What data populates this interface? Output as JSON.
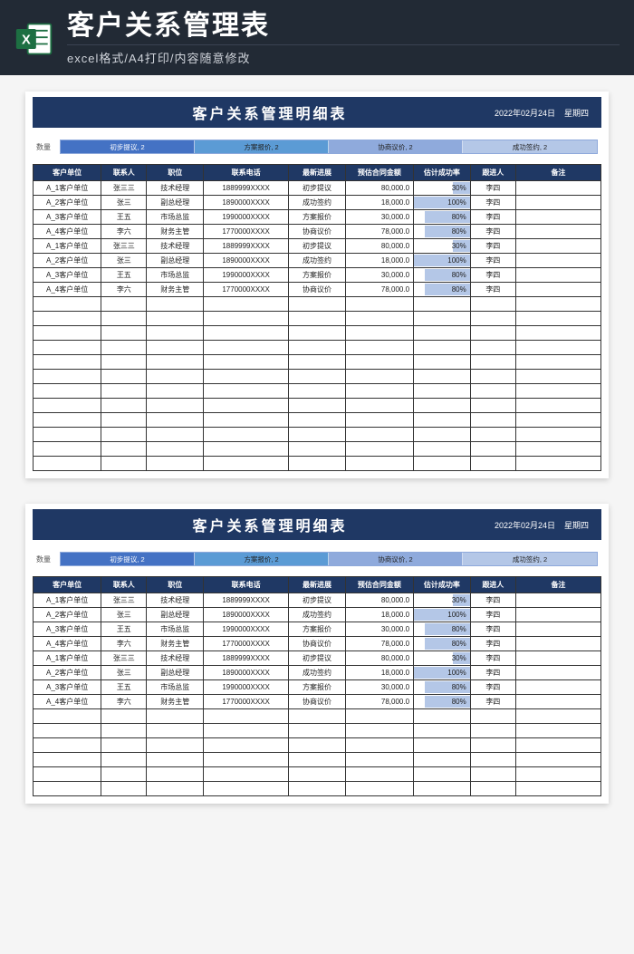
{
  "topbar": {
    "title": "客户关系管理表",
    "subtitle": "excel格式/A4打印/内容随意修改"
  },
  "sheet": {
    "title": "客户关系管理明细表",
    "date": "2022年02月24日",
    "weekday": "星期四",
    "chart_label": "数量",
    "segments": [
      {
        "label": "初步提议, 2",
        "pct": 25
      },
      {
        "label": "方案报价, 2",
        "pct": 25
      },
      {
        "label": "协商议价, 2",
        "pct": 25
      },
      {
        "label": "成功签约, 2",
        "pct": 25
      }
    ],
    "columns": [
      "客户单位",
      "联系人",
      "职位",
      "联系电话",
      "最新进展",
      "预估合同金额",
      "估计成功率",
      "跟进人",
      "备注"
    ],
    "rows": [
      {
        "unit": "A_1客户单位",
        "contact": "张三三",
        "title": "技术经理",
        "phone": "1889999XXXX",
        "progress": "初步提议",
        "amount": "80,000.0",
        "rate": "30%",
        "rate_pct": 30,
        "owner": "李四",
        "remark": ""
      },
      {
        "unit": "A_2客户单位",
        "contact": "张三",
        "title": "副总经理",
        "phone": "1890000XXXX",
        "progress": "成功签约",
        "amount": "18,000.0",
        "rate": "100%",
        "rate_pct": 100,
        "owner": "李四",
        "remark": ""
      },
      {
        "unit": "A_3客户单位",
        "contact": "王五",
        "title": "市场总监",
        "phone": "1990000XXXX",
        "progress": "方案报价",
        "amount": "30,000.0",
        "rate": "80%",
        "rate_pct": 80,
        "owner": "李四",
        "remark": ""
      },
      {
        "unit": "A_4客户单位",
        "contact": "李六",
        "title": "财务主管",
        "phone": "1770000XXXX",
        "progress": "协商议价",
        "amount": "78,000.0",
        "rate": "80%",
        "rate_pct": 80,
        "owner": "李四",
        "remark": ""
      },
      {
        "unit": "A_1客户单位",
        "contact": "张三三",
        "title": "技术经理",
        "phone": "1889999XXXX",
        "progress": "初步提议",
        "amount": "80,000.0",
        "rate": "30%",
        "rate_pct": 30,
        "owner": "李四",
        "remark": ""
      },
      {
        "unit": "A_2客户单位",
        "contact": "张三",
        "title": "副总经理",
        "phone": "1890000XXXX",
        "progress": "成功签约",
        "amount": "18,000.0",
        "rate": "100%",
        "rate_pct": 100,
        "owner": "李四",
        "remark": ""
      },
      {
        "unit": "A_3客户单位",
        "contact": "王五",
        "title": "市场总监",
        "phone": "1990000XXXX",
        "progress": "方案报价",
        "amount": "30,000.0",
        "rate": "80%",
        "rate_pct": 80,
        "owner": "李四",
        "remark": ""
      },
      {
        "unit": "A_4客户单位",
        "contact": "李六",
        "title": "财务主管",
        "phone": "1770000XXXX",
        "progress": "协商议价",
        "amount": "78,000.0",
        "rate": "80%",
        "rate_pct": 80,
        "owner": "李四",
        "remark": ""
      }
    ],
    "empty_rows_top": 12,
    "empty_rows_bottom": 6
  },
  "chart_data": {
    "type": "bar",
    "orientation": "horizontal-stacked",
    "title": "数量",
    "series": [
      {
        "name": "初步提议",
        "values": [
          2
        ]
      },
      {
        "name": "方案报价",
        "values": [
          2
        ]
      },
      {
        "name": "协商议价",
        "values": [
          2
        ]
      },
      {
        "name": "成功签约",
        "values": [
          2
        ]
      }
    ],
    "categories": [
      "数量"
    ],
    "xlabel": "",
    "ylabel": "",
    "ylim": [
      0,
      8
    ]
  }
}
